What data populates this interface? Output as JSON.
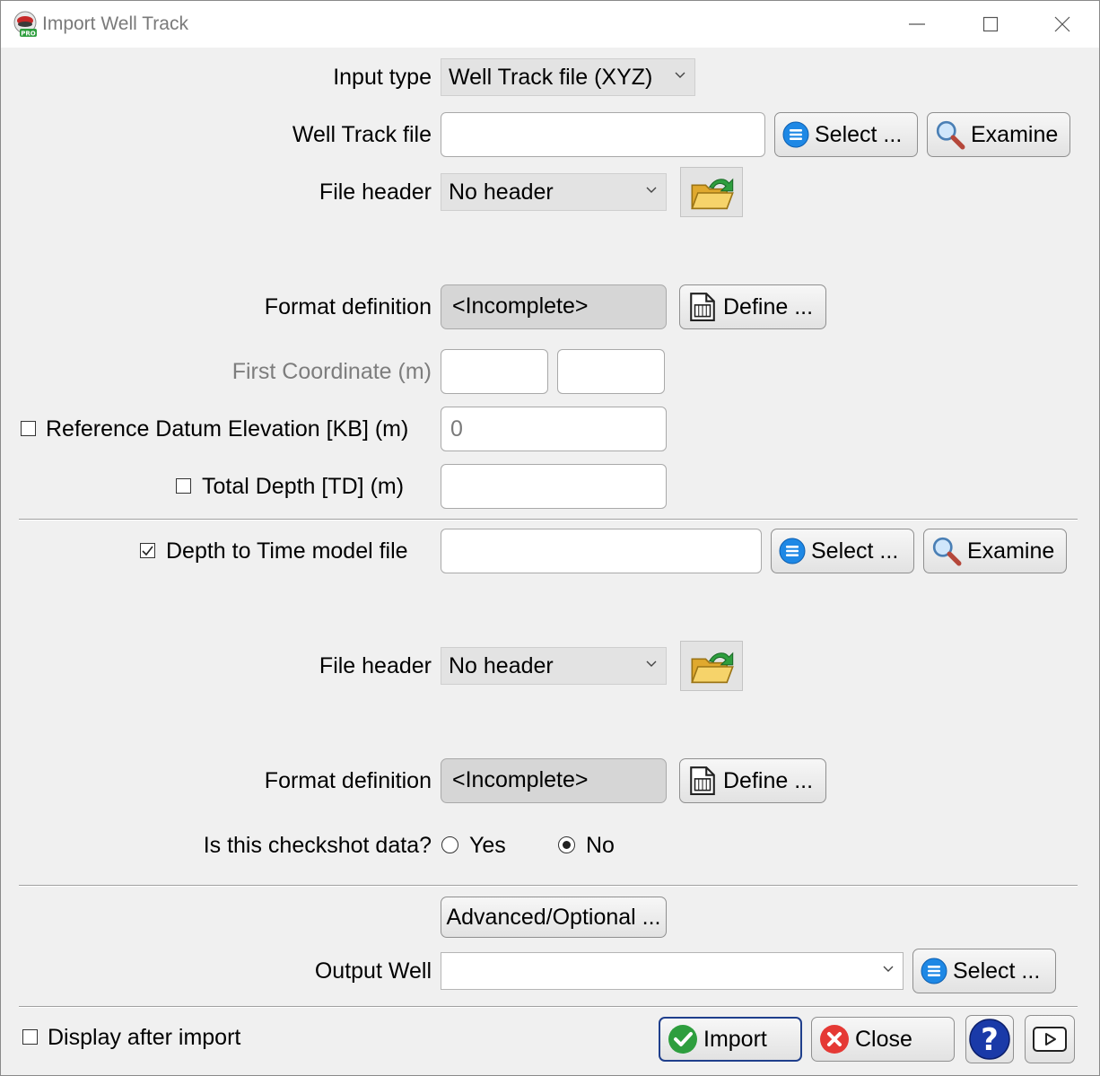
{
  "window": {
    "title": "Import Well Track",
    "app_icon_badge": "PRO"
  },
  "input_type": {
    "label": "Input type",
    "value": "Well Track file (XYZ)"
  },
  "well_track_file": {
    "label": "Well Track file",
    "value": "",
    "select_label": "Select ...",
    "examine_label": "Examine"
  },
  "file_header_1": {
    "label": "File header",
    "value": "No header"
  },
  "format_definition_1": {
    "label": "Format definition",
    "value": "<Incomplete>",
    "define_label": "Define ..."
  },
  "first_coordinate": {
    "label": "First Coordinate (m)",
    "x": "",
    "y": ""
  },
  "reference_datum": {
    "label": "Reference Datum Elevation [KB] (m)",
    "checked": false,
    "value": "0"
  },
  "total_depth": {
    "label": "Total Depth [TD] (m)",
    "checked": false,
    "value": ""
  },
  "depth_time_file": {
    "label": "Depth to Time model file",
    "checked": true,
    "value": "",
    "select_label": "Select ...",
    "examine_label": "Examine"
  },
  "file_header_2": {
    "label": "File header",
    "value": "No header"
  },
  "format_definition_2": {
    "label": "Format definition",
    "value": "<Incomplete>",
    "define_label": "Define ..."
  },
  "checkshot": {
    "label": "Is this checkshot data?",
    "yes_label": "Yes",
    "no_label": "No",
    "selected": "No"
  },
  "advanced_label": "Advanced/Optional ...",
  "output_well": {
    "label": "Output Well",
    "value": "",
    "select_label": "Select ..."
  },
  "footer": {
    "display_after_import_label": "Display after import",
    "display_after_import_checked": false,
    "import_label": "Import",
    "close_label": "Close",
    "help_glyph": "?"
  },
  "colors": {
    "select_blue": "#1e88e5",
    "import_green": "#2e9e3e",
    "close_red": "#e53935",
    "help_navy": "#1a3aa8"
  }
}
